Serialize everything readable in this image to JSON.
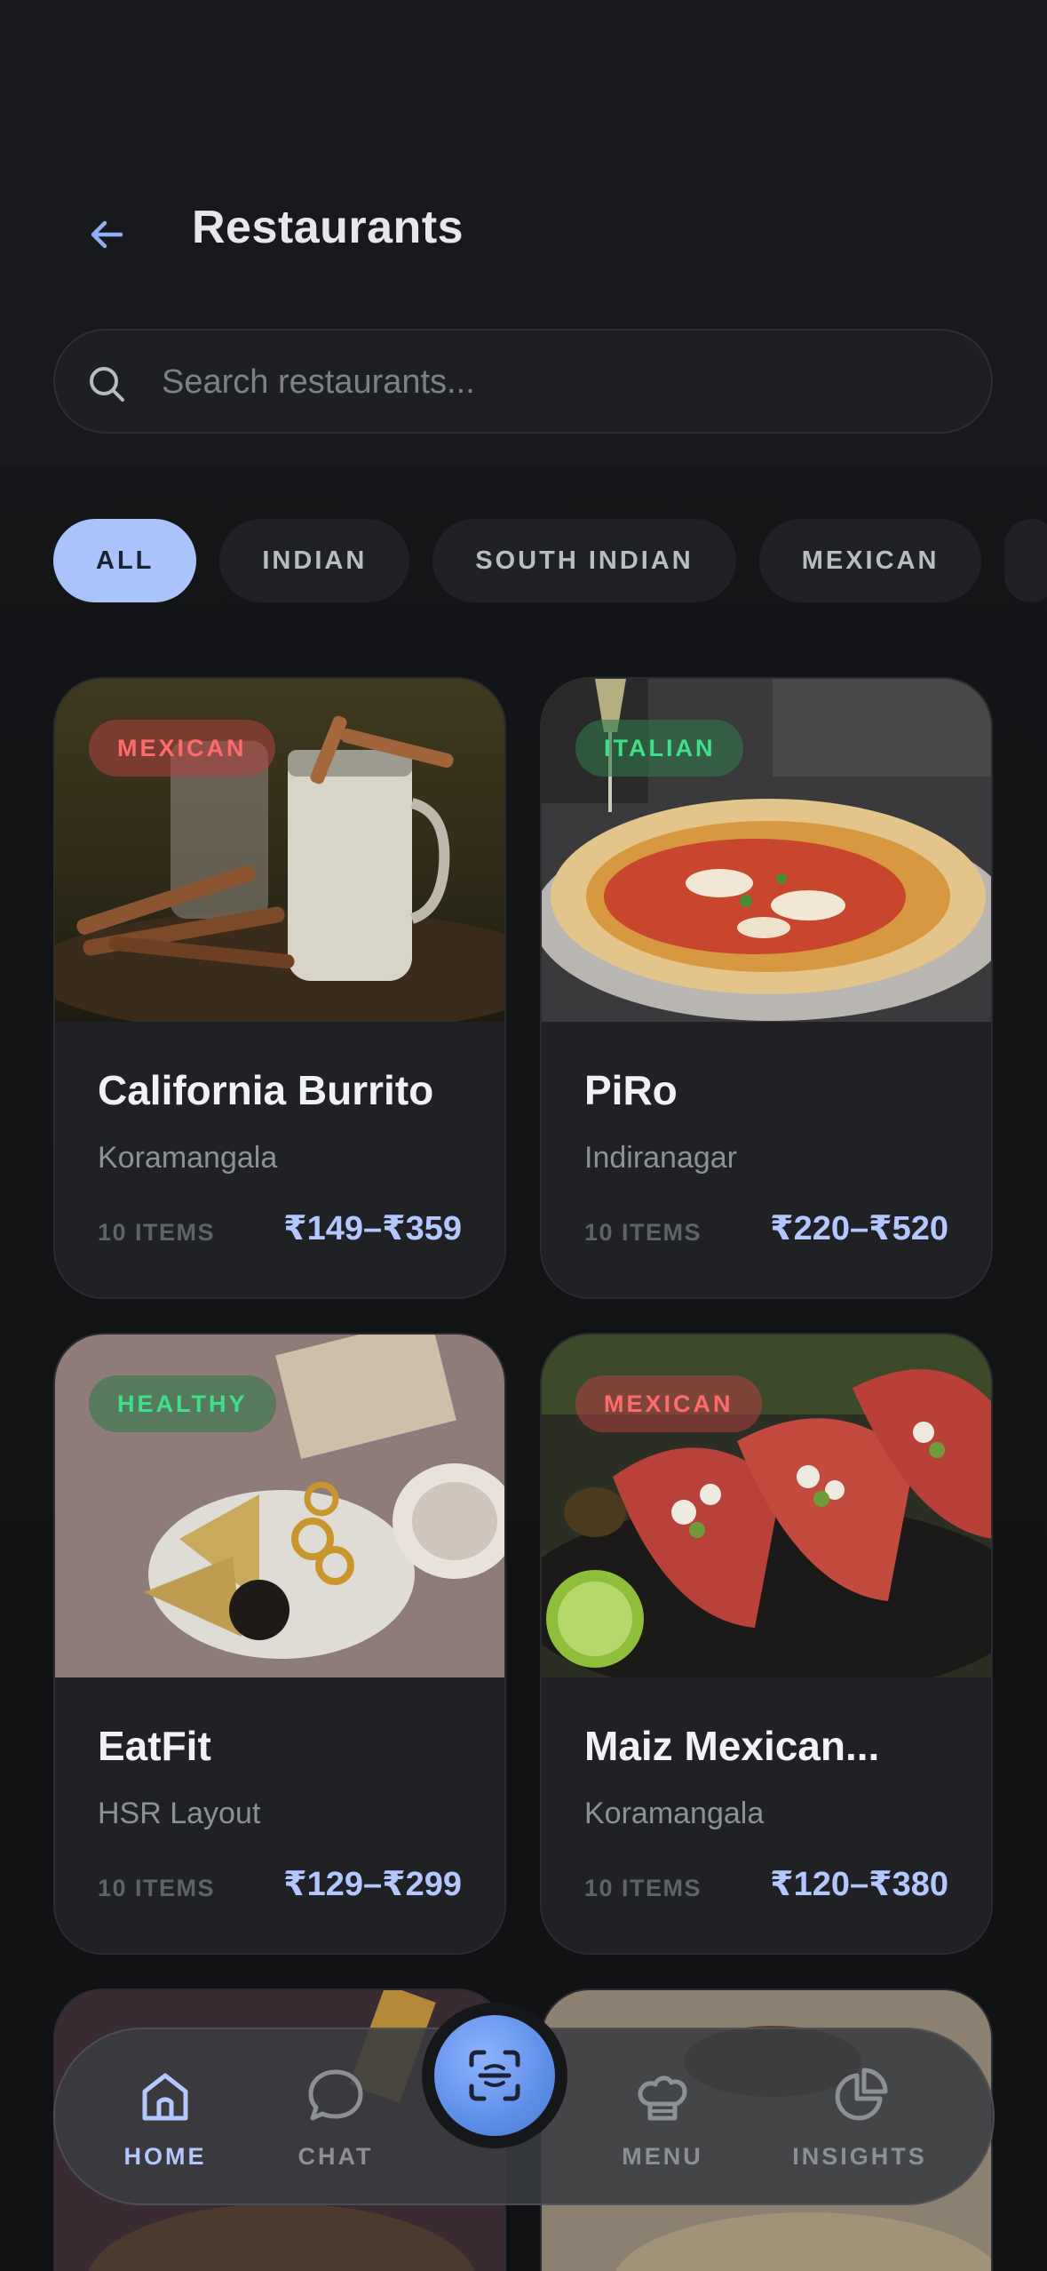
{
  "header": {
    "title": "Restaurants"
  },
  "search": {
    "placeholder": "Search restaurants..."
  },
  "filters": [
    {
      "label": "ALL",
      "active": true
    },
    {
      "label": "INDIAN",
      "active": false
    },
    {
      "label": "SOUTH INDIAN",
      "active": false
    },
    {
      "label": "MEXICAN",
      "active": false
    }
  ],
  "restaurants": [
    {
      "name": "California Burrito",
      "location": "Koramangala",
      "cuisine": "MEXICAN",
      "items": "10 ITEMS",
      "price": "₹149–₹359"
    },
    {
      "name": "PiRo",
      "location": "Indiranagar",
      "cuisine": "ITALIAN",
      "items": "10 ITEMS",
      "price": "₹220–₹520"
    },
    {
      "name": "EatFit",
      "location": "HSR Layout",
      "cuisine": "HEALTHY",
      "items": "10 ITEMS",
      "price": "₹129–₹299"
    },
    {
      "name": "Maiz Mexican...",
      "location": "Koramangala",
      "cuisine": "MEXICAN",
      "items": "10 ITEMS",
      "price": "₹120–₹380"
    }
  ],
  "nav": {
    "home": "HOME",
    "chat": "CHAT",
    "menu": "MENU",
    "insights": "INSIGHTS"
  },
  "colors": {
    "accent": "#aac4fb",
    "price": "#b4c8ff",
    "badge_red": "#ff6b6b",
    "badge_green": "#3fe08a"
  }
}
